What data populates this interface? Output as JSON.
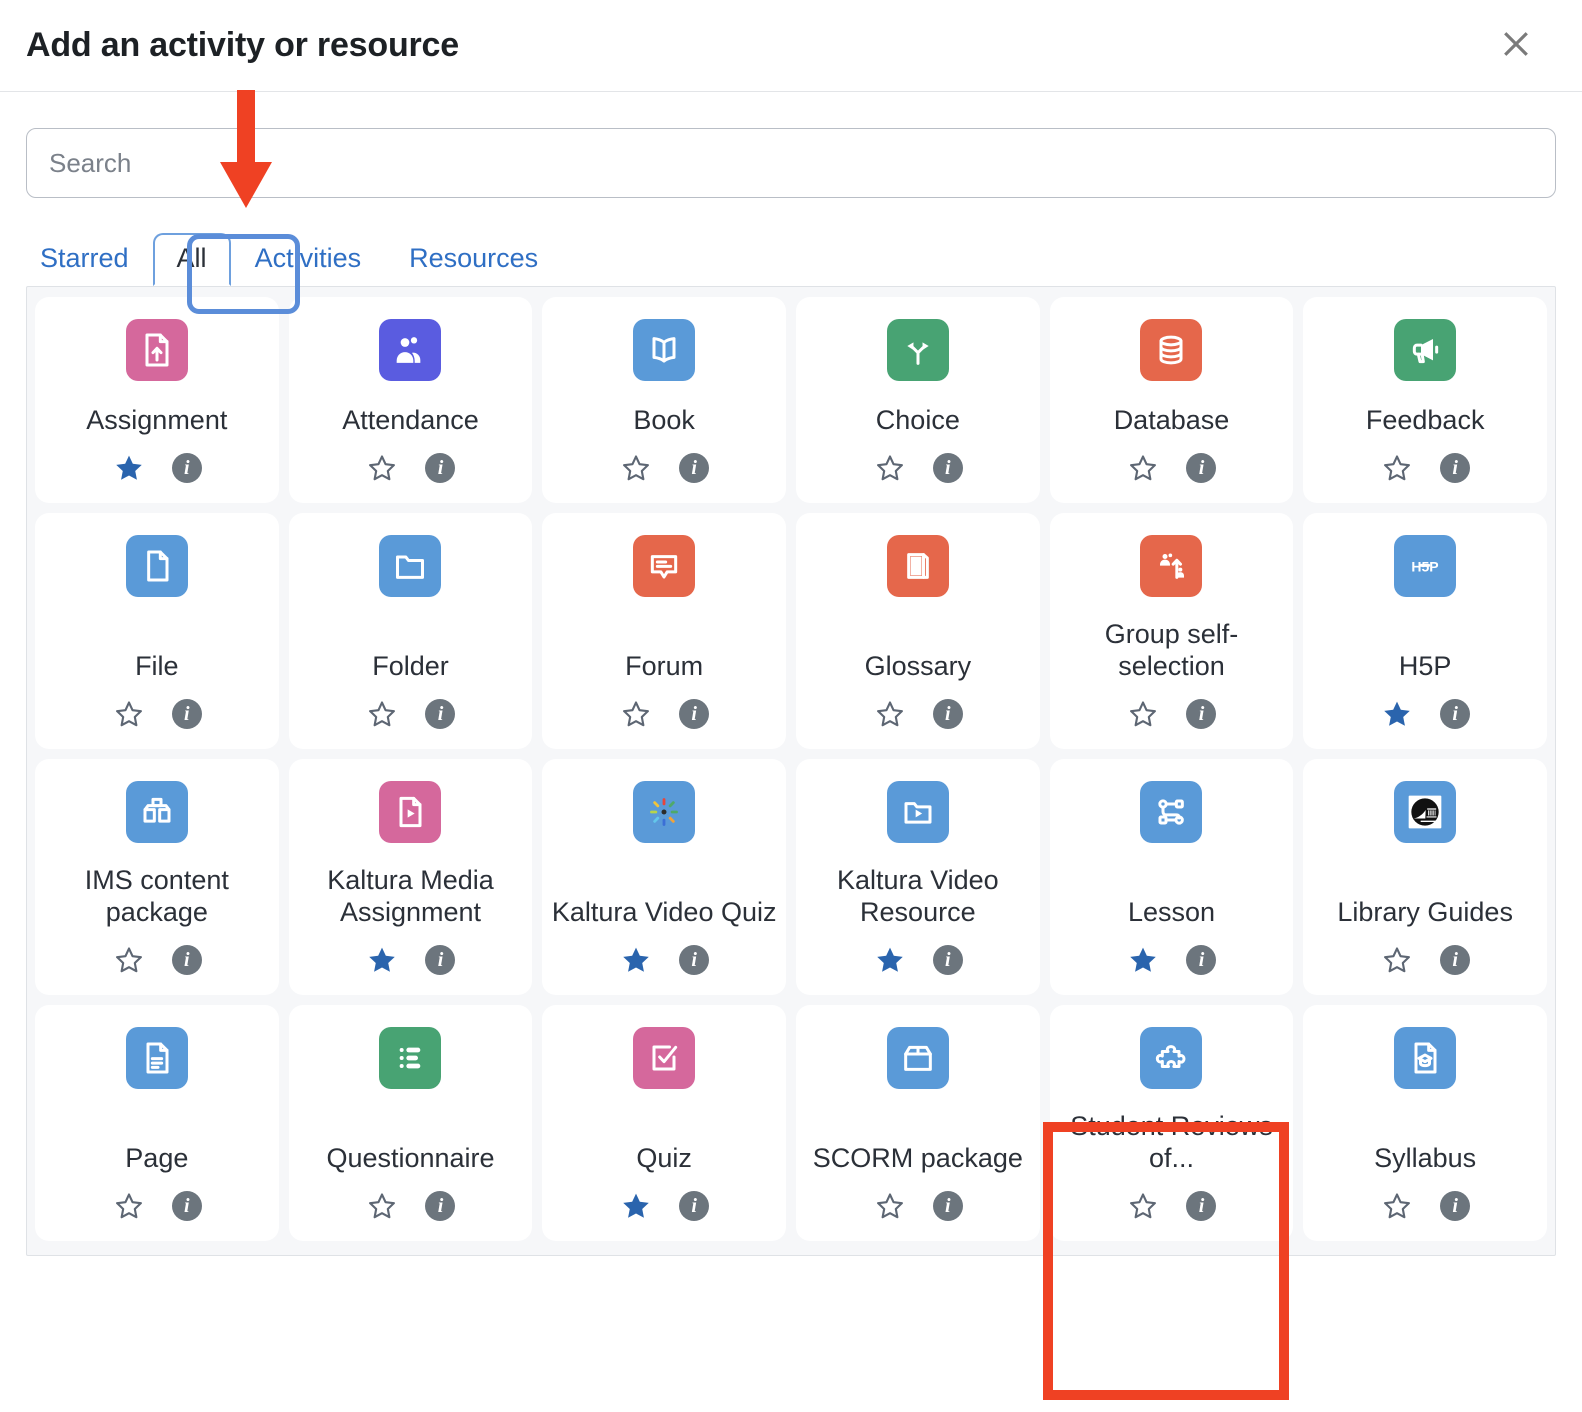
{
  "header": {
    "title": "Add an activity or resource",
    "close_label": "Close",
    "close_icon": "close-icon"
  },
  "search": {
    "placeholder": "Search",
    "value": ""
  },
  "tabs": [
    {
      "label": "Starred",
      "active": false
    },
    {
      "label": "All",
      "active": true
    },
    {
      "label": "Activities",
      "active": false
    },
    {
      "label": "Resources",
      "active": false
    }
  ],
  "annotations": {
    "arrow": {
      "color": "#ef4123",
      "points_to": "All",
      "shape": "down-arrow"
    },
    "tab_highlight": {
      "color": "#5b8dd9",
      "target": "All"
    },
    "tile_highlight": {
      "color": "#ef4123",
      "target": "Student Reviews of..."
    }
  },
  "icons": {
    "star_filled_color": "#2a64ad",
    "star_outline_color": "#5d6673",
    "info_circle_color": "#6c757d",
    "info_glyph": "i"
  },
  "activities": [
    {
      "label": "Assignment",
      "icon": "assignment-icon",
      "icon_color": "#d5689c",
      "starred": true
    },
    {
      "label": "Attendance",
      "icon": "attendance-icon",
      "icon_color": "#5a5ce0",
      "starred": false
    },
    {
      "label": "Book",
      "icon": "book-icon",
      "icon_color": "#5a9ad8",
      "starred": false
    },
    {
      "label": "Choice",
      "icon": "choice-icon",
      "icon_color": "#48a373",
      "starred": false
    },
    {
      "label": "Database",
      "icon": "database-icon",
      "icon_color": "#e5674b",
      "starred": false
    },
    {
      "label": "Feedback",
      "icon": "feedback-icon",
      "icon_color": "#48a373",
      "starred": false
    },
    {
      "label": "File",
      "icon": "file-icon",
      "icon_color": "#5a9ad8",
      "starred": false
    },
    {
      "label": "Folder",
      "icon": "folder-icon",
      "icon_color": "#5a9ad8",
      "starred": false
    },
    {
      "label": "Forum",
      "icon": "forum-icon",
      "icon_color": "#e5674b",
      "starred": false
    },
    {
      "label": "Glossary",
      "icon": "glossary-icon",
      "icon_color": "#e5674b",
      "starred": false
    },
    {
      "label": "Group self-selection",
      "icon": "group-self-selection-icon",
      "icon_color": "#e5674b",
      "starred": false
    },
    {
      "label": "H5P",
      "icon": "h5p-icon",
      "icon_color": "#5a9ad8",
      "starred": true
    },
    {
      "label": "IMS content package",
      "icon": "ims-content-package-icon",
      "icon_color": "#5a9ad8",
      "starred": false
    },
    {
      "label": "Kaltura Media Assignment",
      "icon": "kaltura-media-assignment-icon",
      "icon_color": "#d5689c",
      "starred": true
    },
    {
      "label": "Kaltura Video Quiz",
      "icon": "kaltura-video-quiz-icon",
      "icon_color": "#5a9ad8",
      "starred": true
    },
    {
      "label": "Kaltura Video Resource",
      "icon": "kaltura-video-resource-icon",
      "icon_color": "#5a9ad8",
      "starred": true
    },
    {
      "label": "Lesson",
      "icon": "lesson-icon",
      "icon_color": "#5a9ad8",
      "starred": true
    },
    {
      "label": "Library Guides",
      "icon": "library-guides-icon",
      "icon_color": "#5a9ad8",
      "starred": false
    },
    {
      "label": "Page",
      "icon": "page-icon",
      "icon_color": "#5a9ad8",
      "starred": false
    },
    {
      "label": "Questionnaire",
      "icon": "questionnaire-icon",
      "icon_color": "#48a373",
      "starred": false
    },
    {
      "label": "Quiz",
      "icon": "quiz-icon",
      "icon_color": "#d5689c",
      "starred": true
    },
    {
      "label": "SCORM package",
      "icon": "scorm-package-icon",
      "icon_color": "#5a9ad8",
      "starred": false
    },
    {
      "label": "Student Reviews of...",
      "icon": "student-reviews-icon",
      "icon_color": "#5a9ad8",
      "starred": false
    },
    {
      "label": "Syllabus",
      "icon": "syllabus-icon",
      "icon_color": "#5a9ad8",
      "starred": false
    }
  ]
}
